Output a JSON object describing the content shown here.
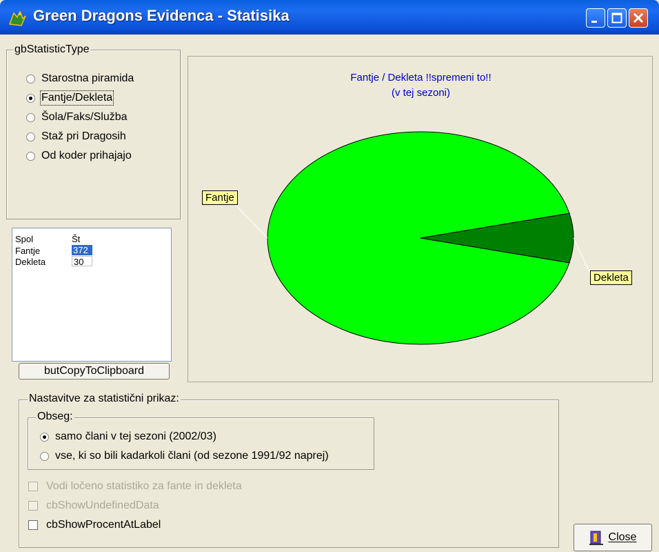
{
  "window": {
    "title": "Green Dragons Evidenca - Statisika"
  },
  "statistic_type": {
    "label": "gbStatisticType",
    "options": [
      {
        "label": "Starostna piramida",
        "checked": false
      },
      {
        "label": "Fantje/Dekleta",
        "checked": true
      },
      {
        "label": "Šola/Faks/Služba",
        "checked": false
      },
      {
        "label": "Staž pri Dragosih",
        "checked": false
      },
      {
        "label": "Od koder prihajajo",
        "checked": false
      }
    ]
  },
  "data_table": {
    "headers": [
      "Spol",
      "Št"
    ],
    "rows": [
      {
        "label": "Fantje",
        "value": "372"
      },
      {
        "label": "Dekleta",
        "value": "30"
      }
    ]
  },
  "copy_button": {
    "label": "butCopyToClipboard"
  },
  "chart_data": {
    "type": "pie",
    "title": "Fantje / Dekleta !!spremeni to!!",
    "subtitle": "(v tej sezoni)",
    "categories": [
      "Fantje",
      "Dekleta"
    ],
    "values": [
      372,
      30
    ],
    "colors": [
      "#00ff00",
      "#008000"
    ]
  },
  "settings": {
    "label": "Nastavitve za statistični prikaz:",
    "range": {
      "label": "Obseg:",
      "options": [
        {
          "label": "samo člani v tej sezoni (2002/03)",
          "checked": true
        },
        {
          "label": "vse, ki so bili kadarkoli člani (od sezone 1991/92 naprej)",
          "checked": false
        }
      ]
    },
    "checkboxes": [
      {
        "label": "Vodi ločeno statistiko za fante in dekleta",
        "enabled": false,
        "checked": false
      },
      {
        "label": "cbShowUndefinedData",
        "enabled": false,
        "checked": false
      },
      {
        "label": "cbShowProcentAtLabel",
        "enabled": true,
        "checked": false
      }
    ]
  },
  "close_button": {
    "label": "Close"
  }
}
